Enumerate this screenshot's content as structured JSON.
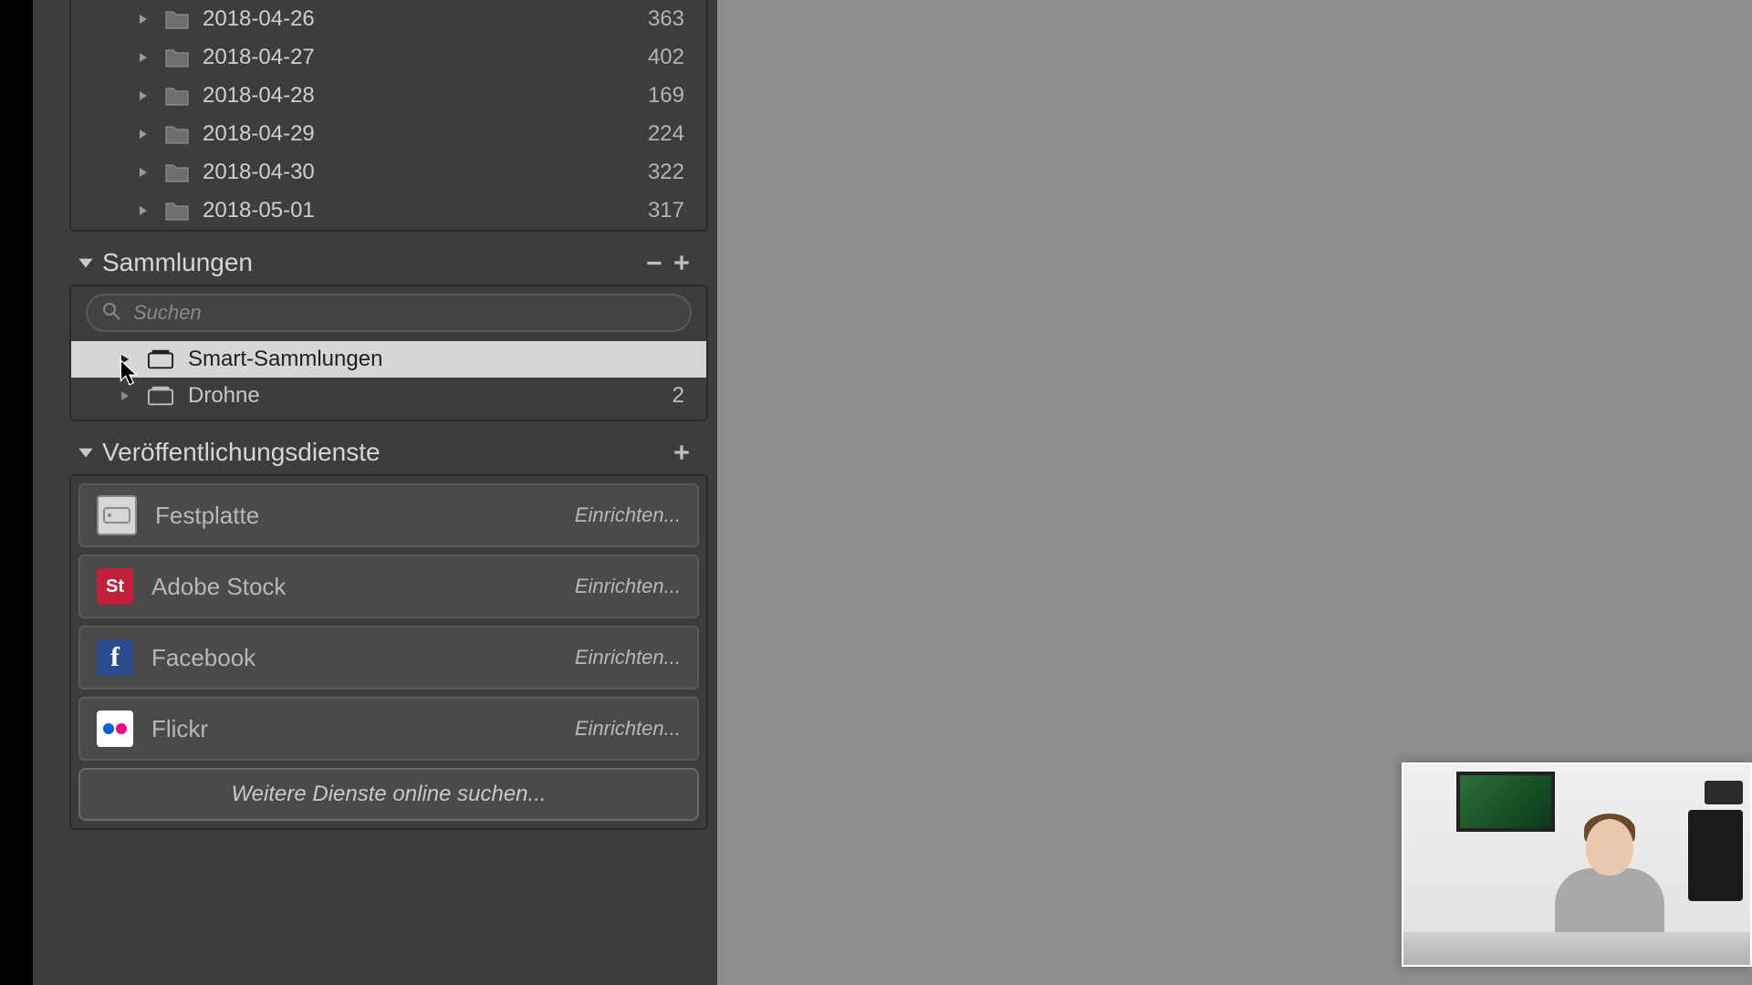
{
  "folders": [
    {
      "name": "2018-04-26",
      "count": 363
    },
    {
      "name": "2018-04-27",
      "count": 402
    },
    {
      "name": "2018-04-28",
      "count": 169
    },
    {
      "name": "2018-04-29",
      "count": 224
    },
    {
      "name": "2018-04-30",
      "count": 322
    },
    {
      "name": "2018-05-01",
      "count": 317
    }
  ],
  "collections": {
    "title": "Sammlungen",
    "search_placeholder": "Suchen",
    "items": [
      {
        "name": "Smart-Sammlungen",
        "count": "",
        "selected": true
      },
      {
        "name": "Drohne",
        "count": 2,
        "selected": false
      }
    ]
  },
  "publish": {
    "title": "Veröffentlichungsdienste",
    "setup_label": "Einrichten...",
    "services": [
      {
        "name": "Festplatte",
        "kind": "hd"
      },
      {
        "name": "Adobe Stock",
        "kind": "st"
      },
      {
        "name": "Facebook",
        "kind": "fb"
      },
      {
        "name": "Flickr",
        "kind": "flk"
      }
    ],
    "find_more": "Weitere Dienste online suchen..."
  },
  "icons": {
    "adobe_stock_glyph": "St",
    "facebook_glyph": "f"
  }
}
